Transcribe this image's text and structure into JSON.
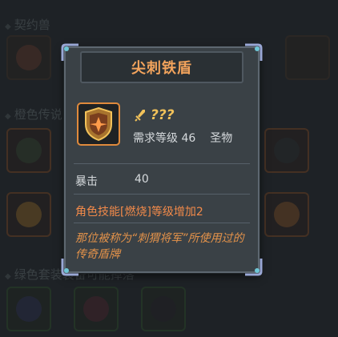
{
  "background": {
    "sections": [
      "契约兽",
      "橙色传说",
      "绿色套装装备"
    ],
    "section_suffix_visible": "可能掉落"
  },
  "tooltip": {
    "title": "尖刺铁盾",
    "item_name": "???",
    "required_level_label": "需求等级",
    "required_level": "46",
    "item_type": "圣物",
    "stat_label": "暴击",
    "stat_value": "40",
    "skill_bonus": "角色技能[燃烧]等级增加2",
    "description": "那位被称为“刺猬将军”所使用过的传奇盾牌"
  },
  "colors": {
    "title": "#f2a35c",
    "item_name": "#f2c25a",
    "skill": "#f28a4a",
    "description": "#e3924a",
    "rarity_border": "#e08a3c"
  },
  "icons": [
    "shield-icon",
    "sword-icon"
  ]
}
